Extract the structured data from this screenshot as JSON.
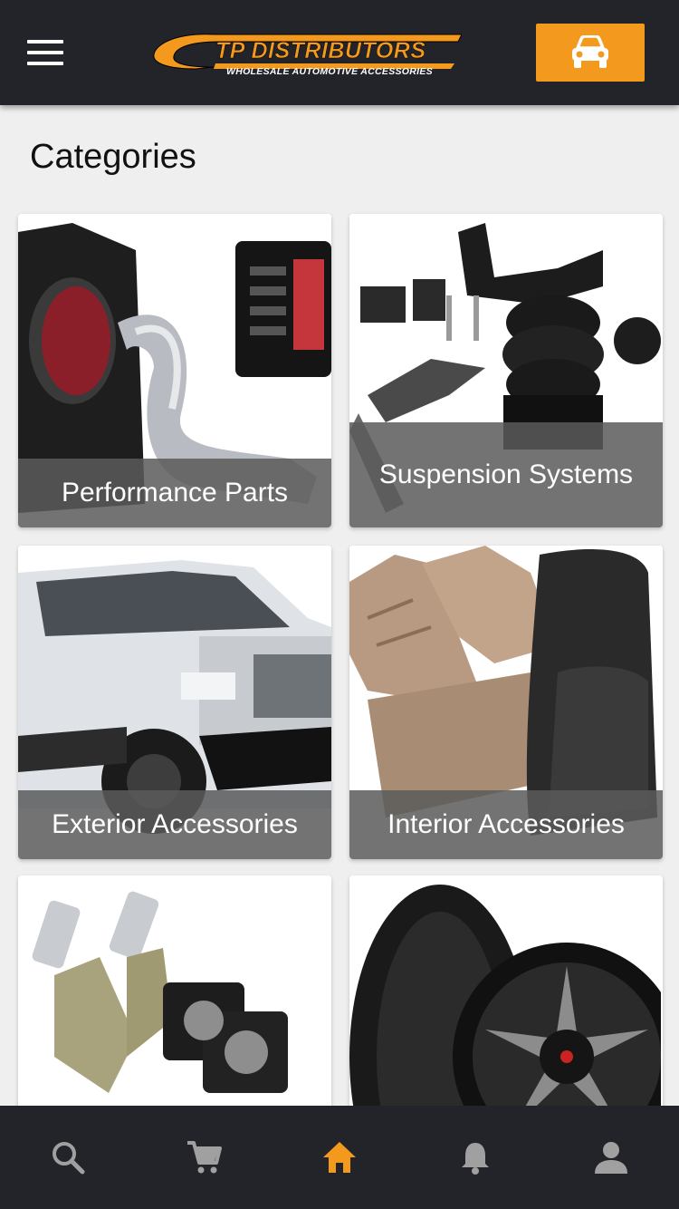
{
  "header": {
    "logo_main": "TP DISTRIBUTORS",
    "logo_sub": "WHOLESALE AUTOMOTIVE ACCESSORIES",
    "menu_icon": "hamburger-menu-icon",
    "vehicle_icon": "car-icon"
  },
  "page": {
    "title": "Categories"
  },
  "categories": [
    {
      "label": "Performance Parts"
    },
    {
      "label": "Suspension Systems"
    },
    {
      "label": "Exterior Accessories"
    },
    {
      "label": "Interior Accessories"
    },
    {
      "label": ""
    },
    {
      "label": ""
    }
  ],
  "bottom_nav": [
    {
      "icon": "search-icon",
      "active": false
    },
    {
      "icon": "cart-icon",
      "active": false
    },
    {
      "icon": "home-icon",
      "active": true
    },
    {
      "icon": "bell-icon",
      "active": false
    },
    {
      "icon": "account-icon",
      "active": false
    }
  ],
  "colors": {
    "accent": "#f39a1e",
    "bar_background": "#232429",
    "page_background": "#efefef",
    "icon_inactive": "#a0a0a0"
  }
}
